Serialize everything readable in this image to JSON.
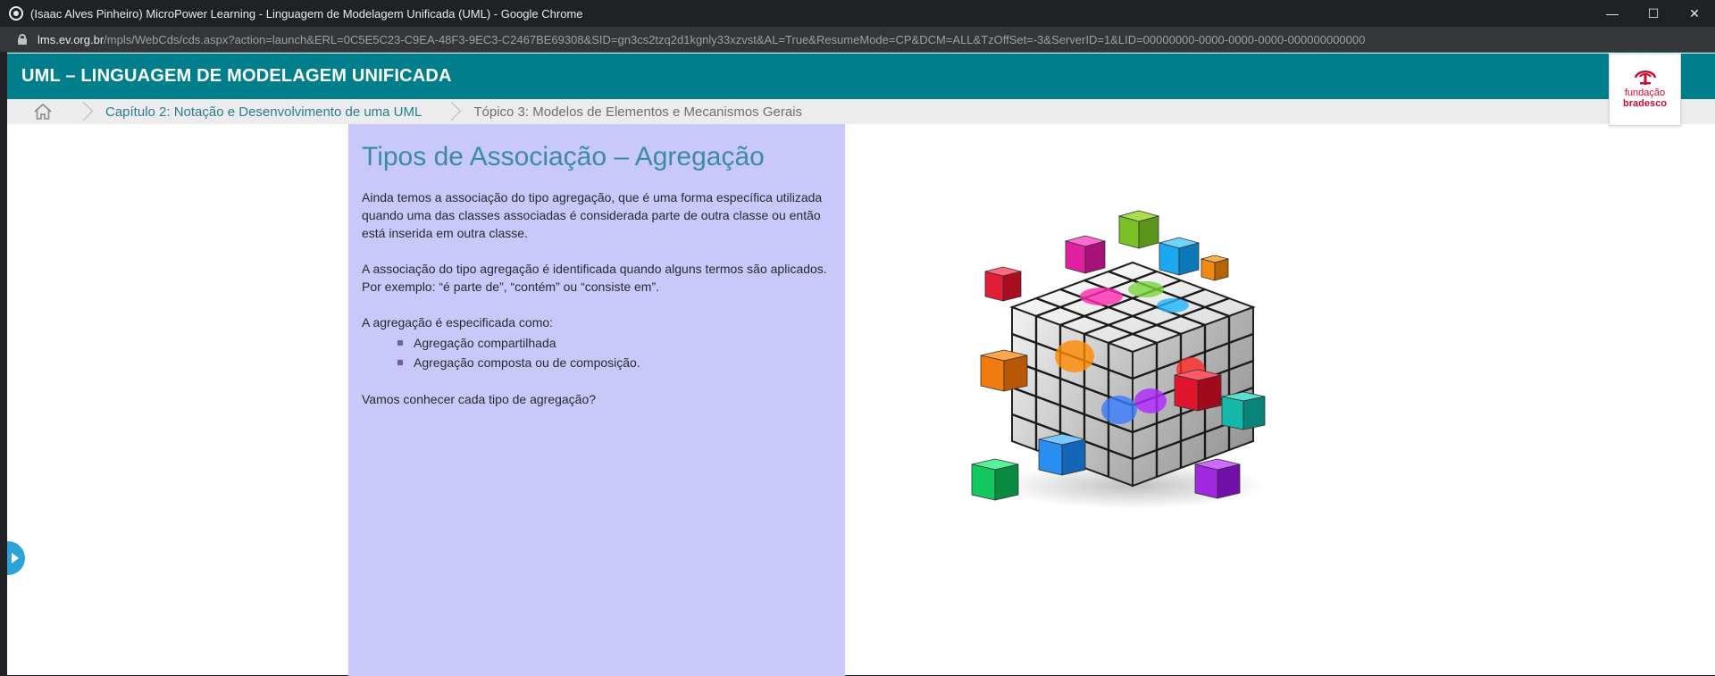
{
  "window": {
    "title": "(Isaac Alves Pinheiro) MicroPower Learning - Linguagem de Modelagem Unificada (UML) - Google Chrome",
    "controls": {
      "minimize": "—",
      "maximize": "☐",
      "close": "✕"
    }
  },
  "address_bar": {
    "host": "lms.ev.org.br",
    "path": "/mpls/WebCds/cds.aspx?action=launch&ERL=0C5E5C23-C9EA-48F3-9EC3-C2467BE69308&SID=gn3cs2tzq2d1kgnly33xzvst&AL=True&ResumeMode=CP&DCM=ALL&TzOffSet=-3&ServerID=1&LID=00000000-0000-0000-0000-000000000000"
  },
  "course": {
    "title": "UML – LINGUAGEM DE MODELAGEM UNIFICADA"
  },
  "breadcrumb": {
    "home_icon": "home-icon",
    "chapter": "Capítulo 2: Notação e Desenvolvimento de uma UML",
    "topic": "Tópico 3: Modelos de Elementos e Mecanismos Gerais"
  },
  "logo": {
    "line1": "fundação",
    "line2": "bradesco",
    "color": "#cc092f"
  },
  "content": {
    "title": "Tipos de Associação – Agregação",
    "paragraph1": "Ainda temos a associação do tipo agregação, que é uma forma específica utilizada quando uma das classes associadas é considerada parte de outra classe ou então está inserida em outra classe.",
    "paragraph2": "A associação do tipo agregação é identificada quando alguns termos são aplicados. Por exemplo: “é parte de”, “contém” ou “consiste em”.",
    "paragraph3": "A agregação é especificada como:",
    "list": [
      "Agregação compartilhada",
      "Agregação composta ou de composição."
    ],
    "paragraph4": "Vamos conhecer cada tipo de agregação?"
  },
  "colors": {
    "header": "#007e8c",
    "panel": "#c8c8fb",
    "title_text": "#3d8aa6",
    "side_tab": "#2ea3d8"
  }
}
